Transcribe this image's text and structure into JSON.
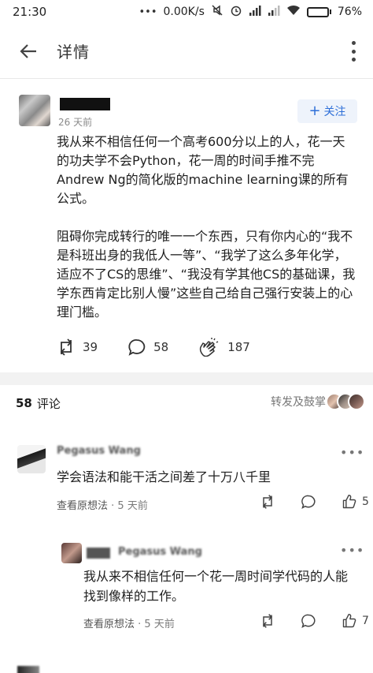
{
  "status": {
    "time": "21:30",
    "speed": "0.00K/s",
    "battery": "76%",
    "battery_level": 0.76
  },
  "appbar": {
    "title": "详情"
  },
  "post": {
    "time": "26 天前",
    "follow_label": "关注",
    "paragraphs": [
      "我从来不相信任何一个高考600分以上的人，花一天的功夫学不会Python，花一周的时间手推不完Andrew Ng的简化版的machine learning课的所有公式。",
      "阻碍你完成转行的唯一一个东西，只有你内心的“我不是科班出身的我低人一等”、“我学了这么多年化学，适应不了CS的思维”、“我没有学其他CS的基础课，我学东西肯定比别人慢”这些自己给自己强行安装上的心理门槛。"
    ],
    "reposts": "39",
    "comments": "58",
    "claps": "187"
  },
  "comments_header": {
    "count": "58",
    "label": "评论",
    "forward_label": "转发及鼓掌"
  },
  "comments": [
    {
      "name": "Pegasus Wang",
      "text": "学会语法和能干活之间差了十万八千里",
      "view_original": "查看原想法",
      "time": "· 5 天前",
      "likes": "5"
    },
    {
      "name": "Pegasus Wang",
      "text": "我从来不相信任何一个花一周时间学代码的人能找到像样的工作。",
      "view_original": "查看原想法",
      "time": "· 5 天前",
      "likes": "7"
    }
  ],
  "icons": {
    "back": "back-arrow-icon",
    "overflow": "more-vertical-icon",
    "repost": "repost-icon",
    "comment": "comment-bubble-icon",
    "clap": "clap-icon",
    "like": "thumbs-up-icon"
  },
  "colors": {
    "accent": "#2e6fd8",
    "follow_bg": "#eef3fb",
    "meta": "#7a7a7a"
  }
}
